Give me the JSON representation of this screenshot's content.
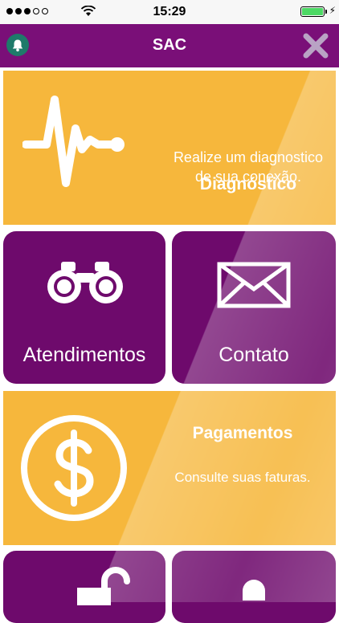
{
  "status_bar": {
    "time": "15:29"
  },
  "header": {
    "title": "SAC"
  },
  "tiles": {
    "diagnostico": {
      "title": "Diagnóstico",
      "description": "Realize um diagnostico de sua conexão."
    },
    "atendimentos": {
      "label": "Atendimentos"
    },
    "contato": {
      "label": "Contato"
    },
    "pagamentos": {
      "title": "Pagamentos",
      "description": "Consulte suas faturas."
    }
  },
  "colors": {
    "purple": "#6e0a6c",
    "header_purple": "#7a0f78",
    "yellow": "#f6b73c",
    "teal": "#1e7a6a"
  },
  "icons": {
    "bell": "bell-icon",
    "close": "close-icon",
    "diagnostico": "pulse-icon",
    "atendimentos": "binoculars-icon",
    "contato": "envelope-icon",
    "pagamentos": "dollar-coin-icon",
    "bottom_left": "lock-icon",
    "bottom_right": "person-icon"
  }
}
